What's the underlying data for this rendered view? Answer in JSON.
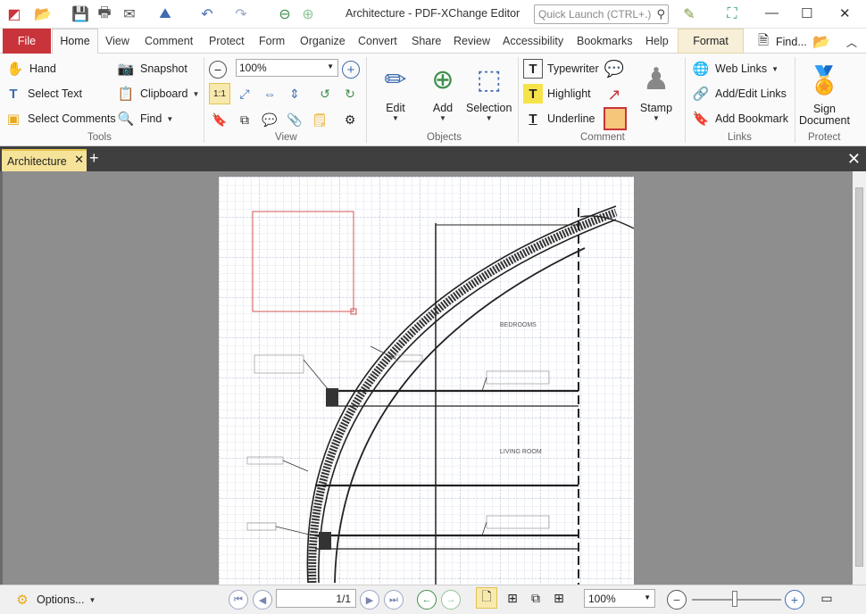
{
  "app": {
    "title": "Architecture - PDF-XChange Editor"
  },
  "quick_launch": {
    "placeholder": "Quick Launch (CTRL+.)"
  },
  "menu": {
    "file": "File",
    "tabs": [
      "Home",
      "View",
      "Comment",
      "Protect",
      "Form",
      "Organize",
      "Convert",
      "Share",
      "Review",
      "Accessibility",
      "Bookmarks",
      "Help"
    ],
    "format": "Format",
    "find": "Find..."
  },
  "ribbon": {
    "tools": {
      "hand": "Hand",
      "select_text": "Select Text",
      "select_comments": "Select Comments",
      "snapshot": "Snapshot",
      "clipboard": "Clipboard",
      "find": "Find",
      "group": "Tools"
    },
    "view": {
      "zoom": "100%",
      "group": "View"
    },
    "objects": {
      "edit": "Edit",
      "add": "Add",
      "selection": "Selection",
      "group": "Objects"
    },
    "comment": {
      "typewriter": "Typewriter",
      "highlight": "Highlight",
      "underline": "Underline",
      "stamp": "Stamp",
      "group": "Comment"
    },
    "links": {
      "web_links": "Web Links",
      "add_edit_links": "Add/Edit Links",
      "add_bookmark": "Add Bookmark",
      "group": "Links"
    },
    "protect": {
      "sign_document_1": "Sign",
      "sign_document_2": "Document",
      "group": "Protect"
    }
  },
  "doc_tab": {
    "label": "Architecture"
  },
  "drawing": {
    "bedrooms": "BEDROOMS",
    "living_room": "LIVING ROOM"
  },
  "status": {
    "options": "Options...",
    "page": "1/1",
    "zoom": "100%"
  },
  "colors": {
    "file_tab": "#c8343a",
    "doc_tab": "#f6e39a",
    "format_tab": "#f7efd8",
    "dark_bar": "#3f3f3f",
    "view_bg": "#8e8e8e"
  }
}
